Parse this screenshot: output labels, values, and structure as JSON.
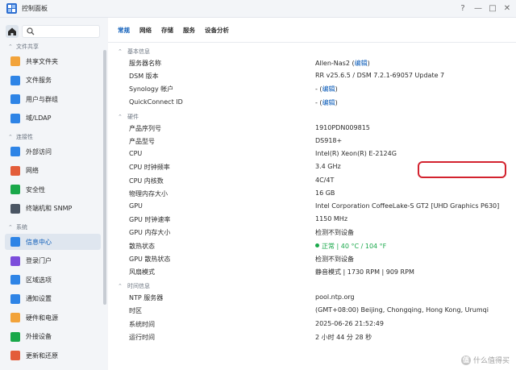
{
  "window": {
    "title": "控制面板",
    "controls": {
      "help": "?",
      "minimize": "—",
      "maximize": "□",
      "close": "✕"
    }
  },
  "sidebar": {
    "search_placeholder": "",
    "sections": [
      {
        "label": "文件共享",
        "items": [
          {
            "label": "共享文件夹",
            "icon": "shared-folder-icon",
            "color": "#f2a33a"
          },
          {
            "label": "文件服务",
            "icon": "file-services-icon",
            "color": "#2e84e6"
          },
          {
            "label": "用户与群组",
            "icon": "user-group-icon",
            "color": "#2e84e6"
          },
          {
            "label": "域/LDAP",
            "icon": "domain-ldap-icon",
            "color": "#2e84e6"
          }
        ]
      },
      {
        "label": "连接性",
        "items": [
          {
            "label": "外部访问",
            "icon": "external-access-icon",
            "color": "#2e84e6"
          },
          {
            "label": "网络",
            "icon": "network-icon",
            "color": "#e35d3a"
          },
          {
            "label": "安全性",
            "icon": "security-icon",
            "color": "#19a84a"
          },
          {
            "label": "终端机和 SNMP",
            "icon": "terminal-snmp-icon",
            "color": "#4a5563"
          }
        ]
      },
      {
        "label": "系统",
        "items": [
          {
            "label": "信息中心",
            "icon": "info-center-icon",
            "color": "#2e84e6",
            "active": true
          },
          {
            "label": "登录门户",
            "icon": "login-portal-icon",
            "color": "#7c4ddb"
          },
          {
            "label": "区域选项",
            "icon": "regional-options-icon",
            "color": "#2e84e6"
          },
          {
            "label": "通知设置",
            "icon": "notification-icon",
            "color": "#2e84e6"
          },
          {
            "label": "硬件和电源",
            "icon": "hardware-power-icon",
            "color": "#f2a33a"
          },
          {
            "label": "外接设备",
            "icon": "external-devices-icon",
            "color": "#19a84a"
          },
          {
            "label": "更新和还原",
            "icon": "update-restore-icon",
            "color": "#e35d3a"
          }
        ]
      }
    ]
  },
  "tabs": [
    "常规",
    "网络",
    "存储",
    "服务",
    "设备分析"
  ],
  "groups": [
    {
      "label": "基本信息",
      "rows": [
        {
          "key": "服务器名称",
          "value": "Allen-Nas2",
          "link": "编辑"
        },
        {
          "key": "DSM 版本",
          "value": "RR v25.6.5 / DSM 7.2.1-69057 Update 7"
        },
        {
          "key": "Synology 帐户",
          "value": "-",
          "link": "编辑"
        },
        {
          "key": "QuickConnect ID",
          "value": "-",
          "link": "编辑"
        }
      ]
    },
    {
      "label": "硬件",
      "rows": [
        {
          "key": "产品序列号",
          "value": "1910PDN009815"
        },
        {
          "key": "产品型号",
          "value": "DS918+"
        },
        {
          "key": "CPU",
          "value": "Intel(R) Xeon(R) E-2124G"
        },
        {
          "key": "CPU 时钟频率",
          "value": "3.4 GHz"
        },
        {
          "key": "CPU 内核数",
          "value": "4C/4T"
        },
        {
          "key": "物理内存大小",
          "value": "16 GB"
        },
        {
          "key": "GPU",
          "value": "Intel Corporation CoffeeLake-S GT2 [UHD Graphics P630]"
        },
        {
          "key": "GPU 时钟速率",
          "value": "1150 MHz"
        },
        {
          "key": "GPU 内存大小",
          "value": "检测不到设备"
        },
        {
          "key": "散热状态",
          "value": "正常 | 40 °C / 104 °F",
          "status_color": "#19a84a"
        },
        {
          "key": "GPU 散热状态",
          "value": "检测不到设备"
        },
        {
          "key": "风扇模式",
          "value": "静音模式 | 1730 RPM | 909 RPM"
        }
      ]
    },
    {
      "label": "时间信息",
      "rows": [
        {
          "key": "NTP 服务器",
          "value": "pool.ntp.org"
        },
        {
          "key": "时区",
          "value": "(GMT+08:00) Beijing, Chongqing, Hong Kong, Urumqi"
        },
        {
          "key": "系统时间",
          "value": "2025-06-26 21:52:49"
        },
        {
          "key": "运行时间",
          "value": "2 小时 44 分 28 秒"
        }
      ]
    }
  ],
  "watermark": {
    "badge": "值",
    "text": "什么值得买"
  },
  "colors": {
    "accent": "#0a5bb8",
    "highlight": "#d3232f",
    "ok": "#19a84a"
  }
}
